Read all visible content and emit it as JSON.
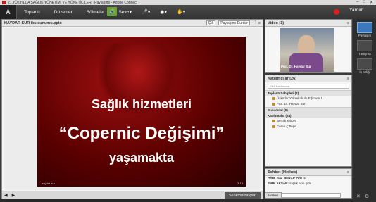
{
  "window": {
    "title": "21.YÜZYILDA SAĞLIK YÖNETİMİ VE YÖNETİCİLERİ (Paylaşım) - Adobe Connect"
  },
  "menu": {
    "items": [
      "Toplantı",
      "Düzenler",
      "Bölmeler",
      "Ses"
    ],
    "help": "Yardım"
  },
  "share": {
    "title": "HAYDAR SUR iku sunumu.pptx",
    "exit_label": "Çık",
    "stop_label": "Paylaşımı Durdur",
    "slide": {
      "line1": "Sağlık hizmetleri",
      "line2": "“Copernic Değişimi”",
      "line3": "yaşamakta",
      "footer": "haydar sur",
      "page": "3-19"
    },
    "sync_label": "Senkronizasyon"
  },
  "video": {
    "title": "Video",
    "count": "(1)",
    "name": "Prof. Dr. Haydar Sur"
  },
  "attendees": {
    "title": "Katılımcılar",
    "count": "(26)",
    "search_placeholder": "Etkil Katılımcılar",
    "groups": [
      {
        "label": "Toplantı Sahipleri (2)",
        "rows": [
          "Üsküdar Yüksekokulu Eğitmen 1",
          "Prof. Dr. Haydar Sur"
        ]
      },
      {
        "label": "Sunucular (0)",
        "rows": []
      },
      {
        "label": "Katılımcılar (24)",
        "rows": [
          "Berrak Kılıçer",
          "Ceren Çiftepe",
          ""
        ]
      }
    ]
  },
  "chat": {
    "title": "Sohbet",
    "scope": "(Herkes)",
    "messages": [
      {
        "sender": "ÖĞR. Gör. BURAK OĞLU:",
        "text": ""
      },
      {
        "sender": "EMİN AKSAN:",
        "text": "sağlık ekip ipdir"
      }
    ],
    "tab": "Herkes"
  },
  "layouts": [
    {
      "label": "Paylaşım",
      "active": true
    },
    {
      "label": "Tartışma",
      "active": false
    },
    {
      "label": "İş birliği",
      "active": false
    }
  ]
}
